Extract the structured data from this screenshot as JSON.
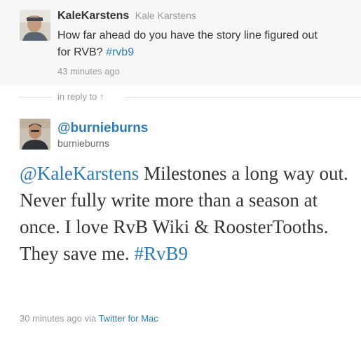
{
  "in_reply_to_tweet": {
    "screen_name": "KaleKarstens",
    "full_name": "Kale Karstens",
    "text_plain": "How far ahead do you have the story line figured out for RVB?",
    "hashtag": "#rvb9",
    "time_ago": "43 minutes ago"
  },
  "divider": {
    "label": "in reply to",
    "arrow": "↑"
  },
  "main_tweet": {
    "handle": "@burnieburns",
    "username": "burnieburns",
    "mention": "@KaleKarstens",
    "text_plain": "Milestones a long way out. Never fully write more than a season at once. I love RvB Wiki & RoosterTooths. They save me.",
    "hashtag": "#RvB9",
    "time_ago": "30 minutes ago",
    "via_label": "via",
    "client": "Twitter for Mac"
  },
  "colors": {
    "link": "#2b7bb9",
    "text": "#333333",
    "muted": "#999999",
    "reply_background": "#f7f7f7"
  }
}
